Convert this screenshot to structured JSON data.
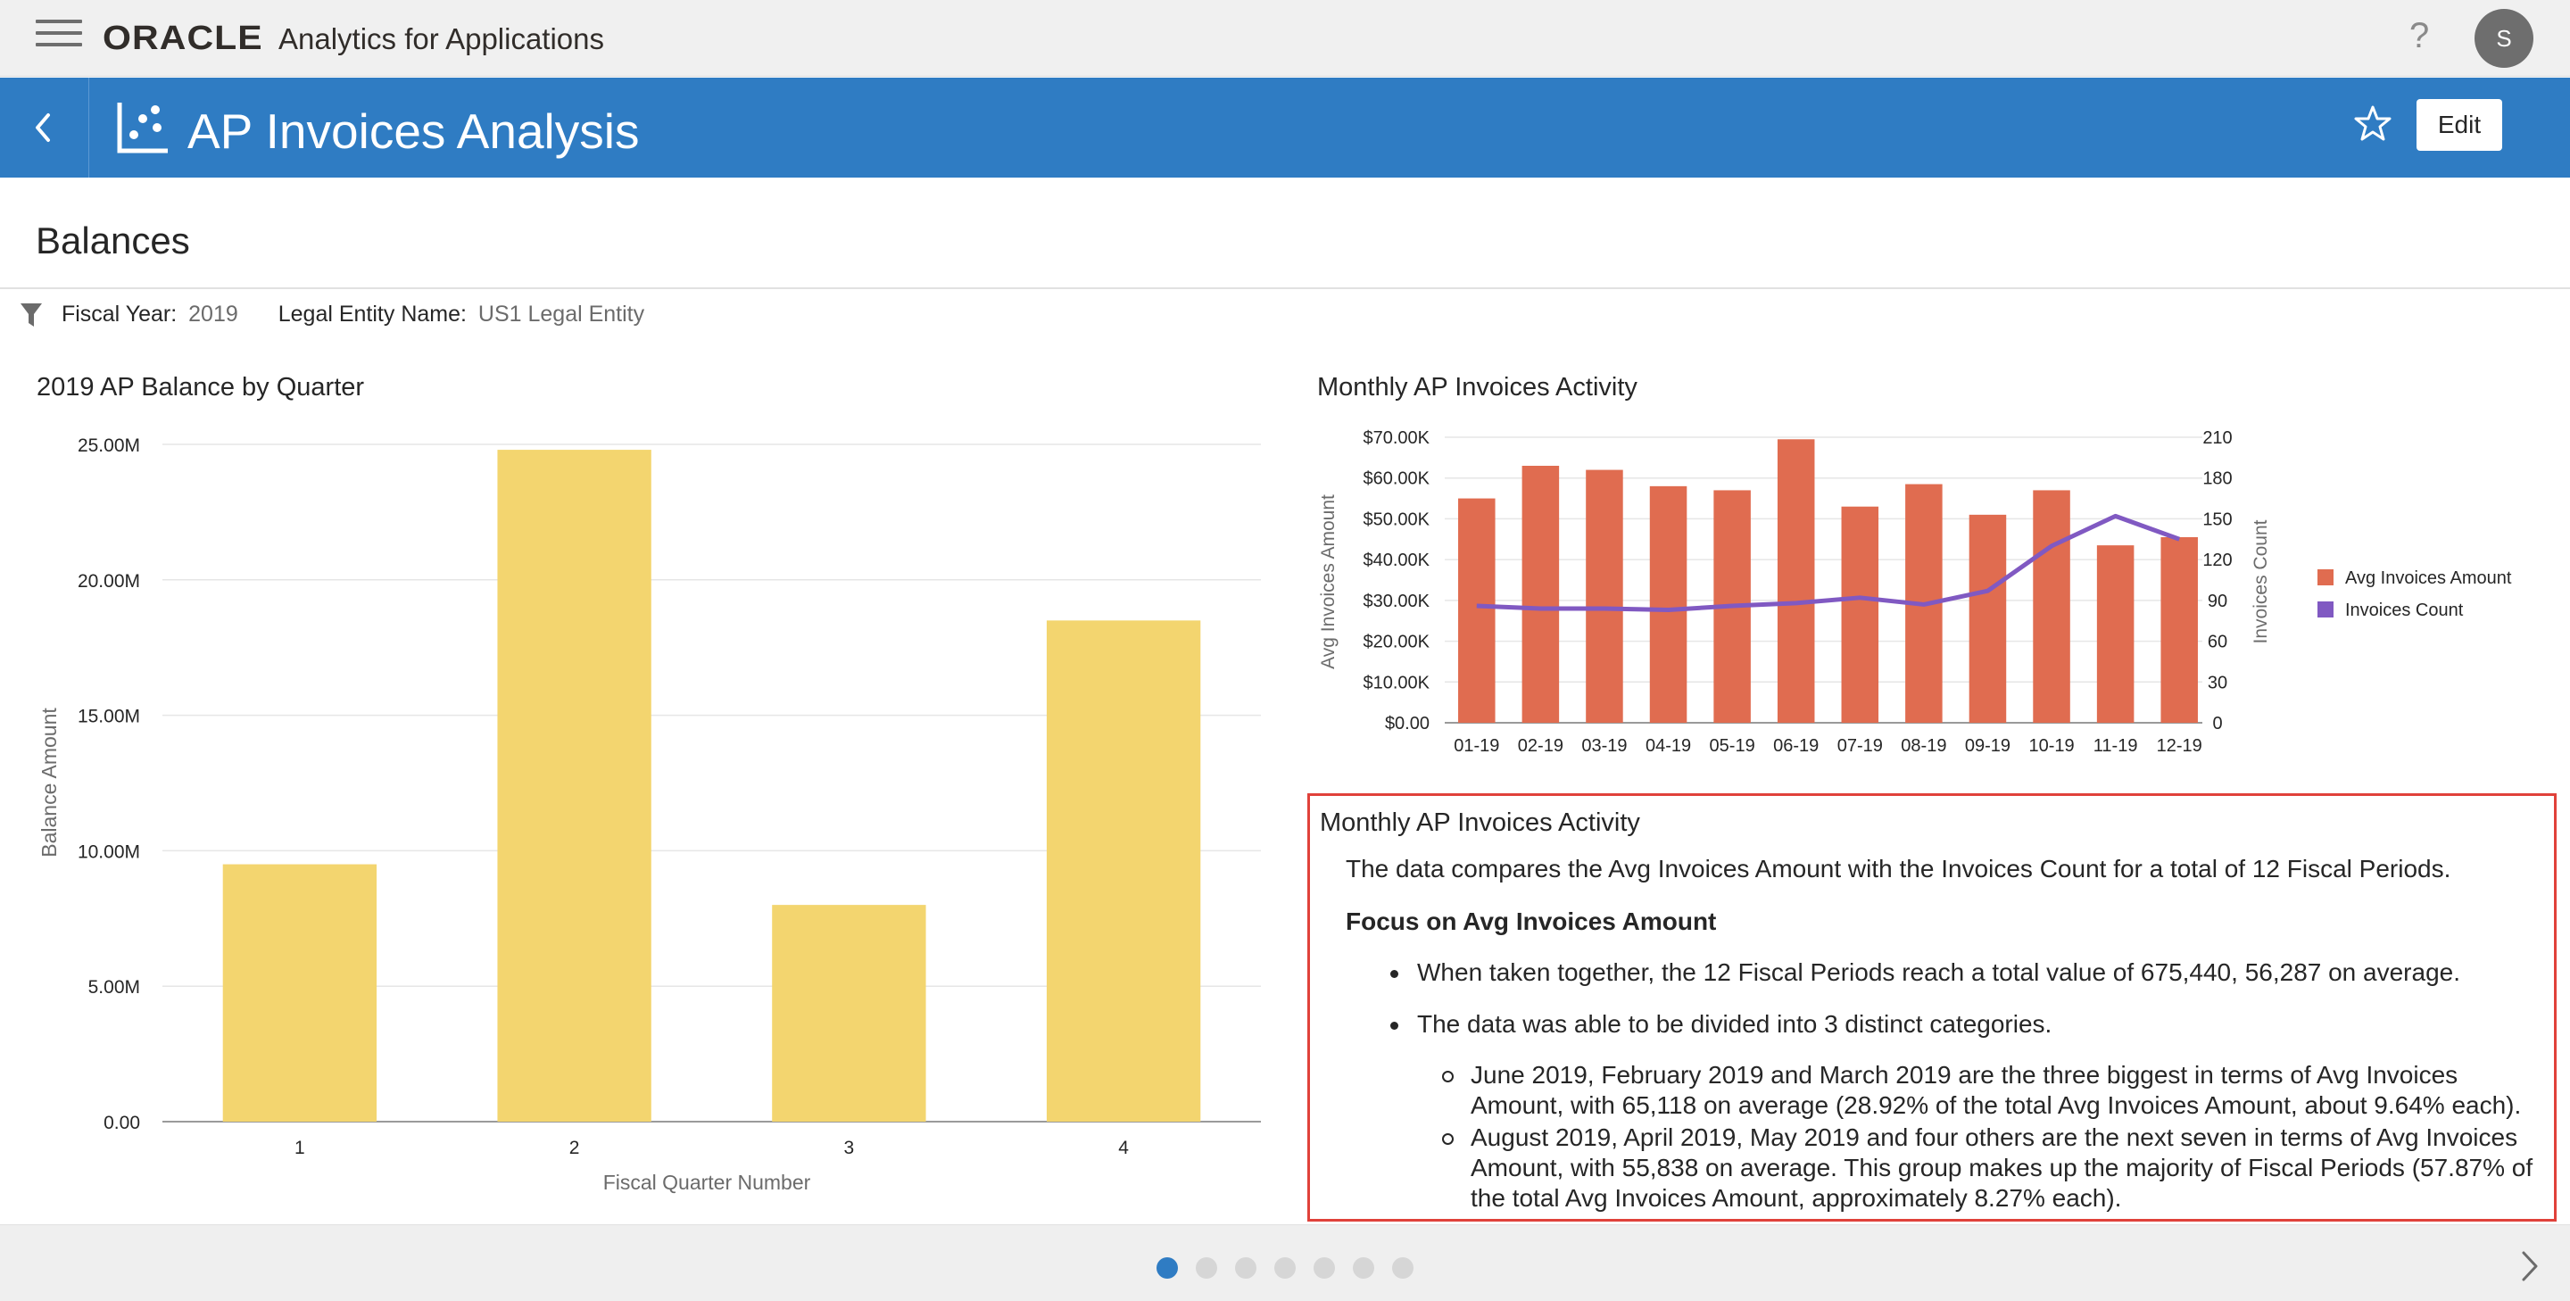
{
  "app": {
    "brand": "ORACLE",
    "product": "Analytics for Applications",
    "help": "?",
    "user_initial": "S"
  },
  "header": {
    "title": "AP Invoices Analysis",
    "edit_label": "Edit",
    "color": "#2f7cc3"
  },
  "section": {
    "title": "Balances"
  },
  "filters": [
    {
      "label": "Fiscal Year:",
      "value": "2019"
    },
    {
      "label": "Legal Entity Name:",
      "value": "US1 Legal Entity"
    }
  ],
  "chart_data": [
    {
      "type": "bar",
      "title": "2019 AP Balance by Quarter",
      "xlabel": "Fiscal Quarter Number",
      "ylabel": "Balance Amount",
      "categories": [
        "1",
        "2",
        "3",
        "4"
      ],
      "values": [
        9.5,
        24.8,
        8.0,
        18.5
      ],
      "ylim": [
        0,
        25
      ],
      "yticks": [
        "0.00",
        "5.00M",
        "10.00M",
        "15.00M",
        "20.00M",
        "25.00M"
      ],
      "bar_color": "#f3d56f",
      "grid": true
    },
    {
      "type": "bar",
      "title": "Monthly AP Invoices Activity",
      "categories": [
        "01-19",
        "02-19",
        "03-19",
        "04-19",
        "05-19",
        "06-19",
        "07-19",
        "08-19",
        "09-19",
        "10-19",
        "11-19",
        "12-19"
      ],
      "ylabel": "Avg Invoices Amount",
      "y2label": "Invoices Count",
      "ylim": [
        0,
        70
      ],
      "y2lim": [
        0,
        210
      ],
      "yticks": [
        "$0.00",
        "$10.00K",
        "$20.00K",
        "$30.00K",
        "$40.00K",
        "$50.00K",
        "$60.00K",
        "$70.00K"
      ],
      "y2ticks": [
        "0",
        "30",
        "60",
        "90",
        "120",
        "150",
        "180",
        "210"
      ],
      "series": [
        {
          "name": "Avg Invoices Amount",
          "type": "bar",
          "color": "#e06c50",
          "values": [
            55.0,
            63.0,
            62.0,
            58.0,
            57.0,
            69.5,
            53.0,
            58.5,
            51.0,
            57.0,
            43.5,
            45.5
          ]
        },
        {
          "name": "Invoices Count",
          "type": "line",
          "axis": "right",
          "color": "#8059c2",
          "values": [
            86,
            84,
            84,
            83,
            86,
            88,
            92,
            87,
            97,
            130,
            152,
            135
          ]
        }
      ],
      "legend": "right",
      "grid": true
    }
  ],
  "narrative": {
    "title": "Monthly AP Invoices Activity",
    "intro": "The data compares the Avg Invoices Amount with the Invoices Count for a total of 12 Fiscal Periods.",
    "focus": "Focus on Avg Invoices Amount",
    "bullets": [
      "When taken together, the 12 Fiscal Periods reach a total value of 675,440, 56,287 on average.",
      "The data was able to be divided into 3 distinct categories."
    ],
    "sub_bullets": [
      "June 2019, February 2019 and March 2019 are the three biggest in terms of Avg Invoices Amount, with 65,118 on average (28.92% of the total Avg Invoices Amount, about 9.64% each).",
      "August 2019, April 2019, May 2019 and four others are the next seven in terms of Avg Invoices Amount, with 55,838 on average. This group makes up the majority of Fiscal Periods (57.87% of the total Avg Invoices Amount, approximately 8.27% each)."
    ],
    "border_color": "#e0413a"
  },
  "pagination": {
    "total": 7,
    "active": 0
  }
}
